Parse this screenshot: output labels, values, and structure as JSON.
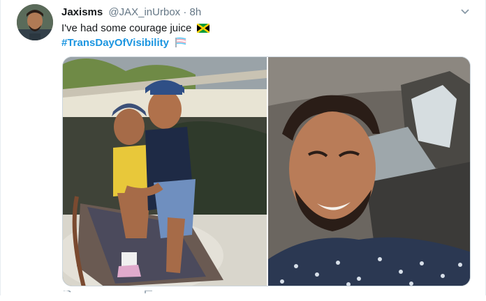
{
  "tweet": {
    "display_name": "Jaxisms",
    "handle": "@JAX_inUrbox",
    "separator": "·",
    "timestamp": "8h",
    "text": "I've had some courage juice",
    "hashtag": "#TransDayOfVisibility"
  },
  "icons": {
    "caret": "chevron-down-icon",
    "jamaica_flag": "jamaica-flag-emoji",
    "trans_flag": "transgender-flag-emoji",
    "reply": "reply-icon",
    "retweet": "retweet-icon"
  },
  "colors": {
    "link": "#1b95e0",
    "secondary_text": "#657786",
    "border": "#e6ecf0"
  }
}
